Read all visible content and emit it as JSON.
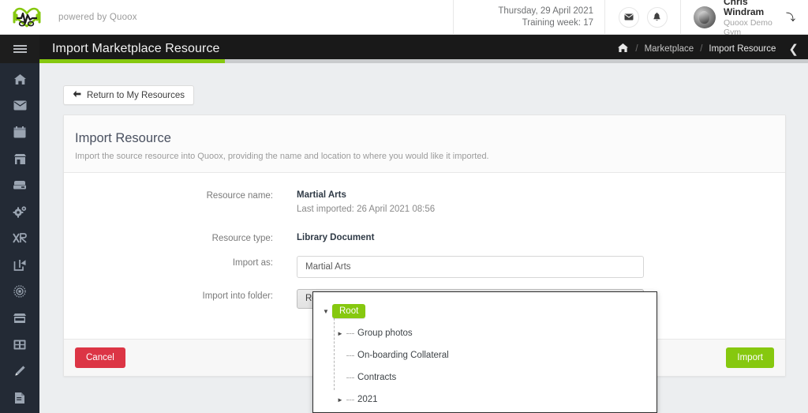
{
  "topbar": {
    "logo_name": "quoox-heart-logo",
    "powered_by": "powered by Quoox",
    "date_line1": "Thursday, 29 April 2021",
    "date_line2": "Training week: 17",
    "mail_icon": "envelope-icon",
    "bell_icon": "bell-icon",
    "user_name": "Chris Windram",
    "user_org": "Quoox Demo Gym",
    "user_caret": "chevron-down-icon"
  },
  "header": {
    "menu_icon": "hamburger-icon",
    "page_title": "Import Marketplace Resource",
    "accent_color": "#86c80f",
    "breadcrumb": {
      "home_icon": "home-icon",
      "sep": "/",
      "items": [
        {
          "label": "Marketplace"
        },
        {
          "label": "Import Resource"
        }
      ],
      "collapse_icon": "chevron-left-icon"
    }
  },
  "sidebar": {
    "items": [
      {
        "icon": "home-icon"
      },
      {
        "icon": "envelope-icon"
      },
      {
        "icon": "calendar-icon"
      },
      {
        "icon": "store-icon"
      },
      {
        "icon": "drawer-icon"
      },
      {
        "icon": "gears-icon"
      },
      {
        "icon": "xr-icon"
      },
      {
        "icon": "share-export-icon"
      },
      {
        "icon": "badge-gear-icon"
      },
      {
        "icon": "marketplace-shop-icon"
      },
      {
        "icon": "grid-icon"
      },
      {
        "icon": "pencil-icon"
      },
      {
        "icon": "document-icon"
      }
    ]
  },
  "page": {
    "return_button": {
      "icon": "arrow-left-icon",
      "label": "Return to My Resources"
    },
    "card": {
      "title": "Import Resource",
      "subtitle": "Import the source resource into Quoox, providing the name and location to where you would like it imported.",
      "fields": {
        "resource_name_label": "Resource name:",
        "resource_name_value": "Martial Arts",
        "resource_name_meta": "Last imported: 26 April 2021 08:56",
        "resource_type_label": "Resource type:",
        "resource_type_value": "Library Document",
        "import_as_label": "Import as:",
        "import_as_value": "Martial Arts",
        "import_folder_label": "Import into folder:",
        "import_folder_value": "Root",
        "import_folder_caret": "caret-down-icon"
      },
      "footer": {
        "cancel_label": "Cancel",
        "cancel_color": "#dc3545",
        "import_label": "Import",
        "import_color": "#86c80f"
      }
    },
    "folder_tree": {
      "root": {
        "label": "Root",
        "toggle": "▼",
        "selected": true
      },
      "children": [
        {
          "label": "Group photos",
          "toggle": "►",
          "expandable": true
        },
        {
          "label": "On-boarding Collateral",
          "toggle": "",
          "expandable": false
        },
        {
          "label": "Contracts",
          "toggle": "",
          "expandable": false
        },
        {
          "label": "2021",
          "toggle": "►",
          "expandable": true
        }
      ]
    }
  }
}
